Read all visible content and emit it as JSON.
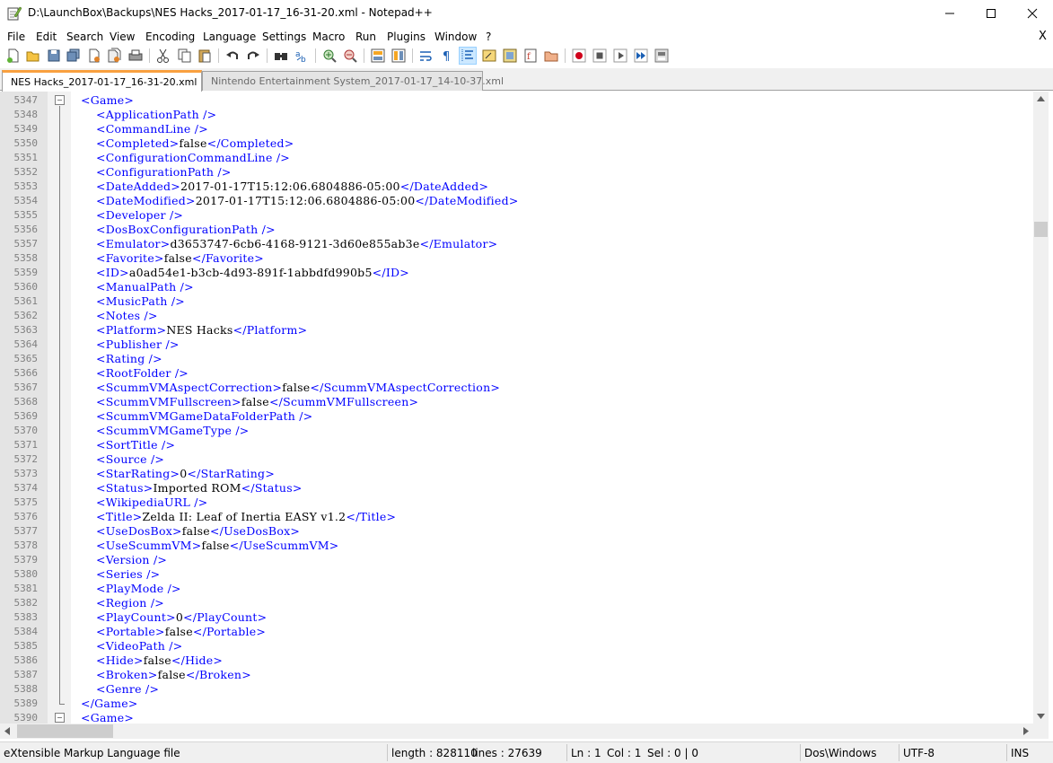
{
  "window": {
    "title": "D:\\LaunchBox\\Backups\\NES Hacks_2017-01-17_16-31-20.xml - Notepad++",
    "icon": "notepad-plus-plus-icon"
  },
  "menu": {
    "items": [
      "File",
      "Edit",
      "Search",
      "View",
      "Encoding",
      "Language",
      "Settings",
      "Macro",
      "Run",
      "Plugins",
      "Window",
      "?"
    ],
    "close_glyph": "X"
  },
  "tabs": [
    {
      "label": "NES Hacks_2017-01-17_16-31-20.xml",
      "active": true
    },
    {
      "label": "Nintendo Entertainment System_2017-01-17_14-10-37.xml",
      "active": false
    }
  ],
  "editor": {
    "lines": [
      {
        "n": "5347",
        "tag_open": "<Game>",
        "value": "",
        "tag_close": "",
        "indent": 0
      },
      {
        "n": "5348",
        "tag_open": "<ApplicationPath />",
        "value": "",
        "tag_close": "",
        "indent": 1
      },
      {
        "n": "5349",
        "tag_open": "<CommandLine />",
        "value": "",
        "tag_close": "",
        "indent": 1
      },
      {
        "n": "5350",
        "tag_open": "<Completed>",
        "value": "false",
        "tag_close": "</Completed>",
        "indent": 1
      },
      {
        "n": "5351",
        "tag_open": "<ConfigurationCommandLine />",
        "value": "",
        "tag_close": "",
        "indent": 1
      },
      {
        "n": "5352",
        "tag_open": "<ConfigurationPath />",
        "value": "",
        "tag_close": "",
        "indent": 1
      },
      {
        "n": "5353",
        "tag_open": "<DateAdded>",
        "value": "2017-01-17T15:12:06.6804886-05:00",
        "tag_close": "</DateAdded>",
        "indent": 1
      },
      {
        "n": "5354",
        "tag_open": "<DateModified>",
        "value": "2017-01-17T15:12:06.6804886-05:00",
        "tag_close": "</DateModified>",
        "indent": 1
      },
      {
        "n": "5355",
        "tag_open": "<Developer />",
        "value": "",
        "tag_close": "",
        "indent": 1
      },
      {
        "n": "5356",
        "tag_open": "<DosBoxConfigurationPath />",
        "value": "",
        "tag_close": "",
        "indent": 1
      },
      {
        "n": "5357",
        "tag_open": "<Emulator>",
        "value": "d3653747-6cb6-4168-9121-3d60e855ab3e",
        "tag_close": "</Emulator>",
        "indent": 1
      },
      {
        "n": "5358",
        "tag_open": "<Favorite>",
        "value": "false",
        "tag_close": "</Favorite>",
        "indent": 1
      },
      {
        "n": "5359",
        "tag_open": "<ID>",
        "value": "a0ad54e1-b3cb-4d93-891f-1abbdfd990b5",
        "tag_close": "</ID>",
        "indent": 1
      },
      {
        "n": "5360",
        "tag_open": "<ManualPath />",
        "value": "",
        "tag_close": "",
        "indent": 1
      },
      {
        "n": "5361",
        "tag_open": "<MusicPath />",
        "value": "",
        "tag_close": "",
        "indent": 1
      },
      {
        "n": "5362",
        "tag_open": "<Notes />",
        "value": "",
        "tag_close": "",
        "indent": 1
      },
      {
        "n": "5363",
        "tag_open": "<Platform>",
        "value": "NES Hacks",
        "tag_close": "</Platform>",
        "indent": 1
      },
      {
        "n": "5364",
        "tag_open": "<Publisher />",
        "value": "",
        "tag_close": "",
        "indent": 1
      },
      {
        "n": "5365",
        "tag_open": "<Rating />",
        "value": "",
        "tag_close": "",
        "indent": 1
      },
      {
        "n": "5366",
        "tag_open": "<RootFolder />",
        "value": "",
        "tag_close": "",
        "indent": 1
      },
      {
        "n": "5367",
        "tag_open": "<ScummVMAspectCorrection>",
        "value": "false",
        "tag_close": "</ScummVMAspectCorrection>",
        "indent": 1
      },
      {
        "n": "5368",
        "tag_open": "<ScummVMFullscreen>",
        "value": "false",
        "tag_close": "</ScummVMFullscreen>",
        "indent": 1
      },
      {
        "n": "5369",
        "tag_open": "<ScummVMGameDataFolderPath />",
        "value": "",
        "tag_close": "",
        "indent": 1
      },
      {
        "n": "5370",
        "tag_open": "<ScummVMGameType />",
        "value": "",
        "tag_close": "",
        "indent": 1
      },
      {
        "n": "5371",
        "tag_open": "<SortTitle />",
        "value": "",
        "tag_close": "",
        "indent": 1
      },
      {
        "n": "5372",
        "tag_open": "<Source />",
        "value": "",
        "tag_close": "",
        "indent": 1
      },
      {
        "n": "5373",
        "tag_open": "<StarRating>",
        "value": "0",
        "tag_close": "</StarRating>",
        "indent": 1
      },
      {
        "n": "5374",
        "tag_open": "<Status>",
        "value": "Imported ROM",
        "tag_close": "</Status>",
        "indent": 1
      },
      {
        "n": "5375",
        "tag_open": "<WikipediaURL />",
        "value": "",
        "tag_close": "",
        "indent": 1
      },
      {
        "n": "5376",
        "tag_open": "<Title>",
        "value": "Zelda II: Leaf of Inertia EASY v1.2",
        "tag_close": "</Title>",
        "indent": 1
      },
      {
        "n": "5377",
        "tag_open": "<UseDosBox>",
        "value": "false",
        "tag_close": "</UseDosBox>",
        "indent": 1
      },
      {
        "n": "5378",
        "tag_open": "<UseScummVM>",
        "value": "false",
        "tag_close": "</UseScummVM>",
        "indent": 1
      },
      {
        "n": "5379",
        "tag_open": "<Version />",
        "value": "",
        "tag_close": "",
        "indent": 1
      },
      {
        "n": "5380",
        "tag_open": "<Series />",
        "value": "",
        "tag_close": "",
        "indent": 1
      },
      {
        "n": "5381",
        "tag_open": "<PlayMode />",
        "value": "",
        "tag_close": "",
        "indent": 1
      },
      {
        "n": "5382",
        "tag_open": "<Region />",
        "value": "",
        "tag_close": "",
        "indent": 1
      },
      {
        "n": "5383",
        "tag_open": "<PlayCount>",
        "value": "0",
        "tag_close": "</PlayCount>",
        "indent": 1
      },
      {
        "n": "5384",
        "tag_open": "<Portable>",
        "value": "false",
        "tag_close": "</Portable>",
        "indent": 1
      },
      {
        "n": "5385",
        "tag_open": "<VideoPath />",
        "value": "",
        "tag_close": "",
        "indent": 1
      },
      {
        "n": "5386",
        "tag_open": "<Hide>",
        "value": "false",
        "tag_close": "</Hide>",
        "indent": 1
      },
      {
        "n": "5387",
        "tag_open": "<Broken>",
        "value": "false",
        "tag_close": "</Broken>",
        "indent": 1
      },
      {
        "n": "5388",
        "tag_open": "<Genre />",
        "value": "",
        "tag_close": "",
        "indent": 1
      },
      {
        "n": "5389",
        "tag_open": "</Game>",
        "value": "",
        "tag_close": "",
        "indent": 0
      },
      {
        "n": "5390",
        "tag_open": "<Game>",
        "value": "",
        "tag_close": "",
        "indent": 0
      }
    ]
  },
  "statusbar": {
    "file_type": "eXtensible Markup Language file",
    "length": "length : 828110",
    "lines": "lines : 27639",
    "ln": "Ln : 1",
    "col": "Col : 1",
    "sel": "Sel : 0 | 0",
    "eol": "Dos\\Windows",
    "encoding": "UTF-8",
    "mode": "INS"
  },
  "colors": {
    "tag": "#0000ff",
    "text": "#000000",
    "line_number": "#808080",
    "active_tab_accent": "#f9a03f"
  }
}
